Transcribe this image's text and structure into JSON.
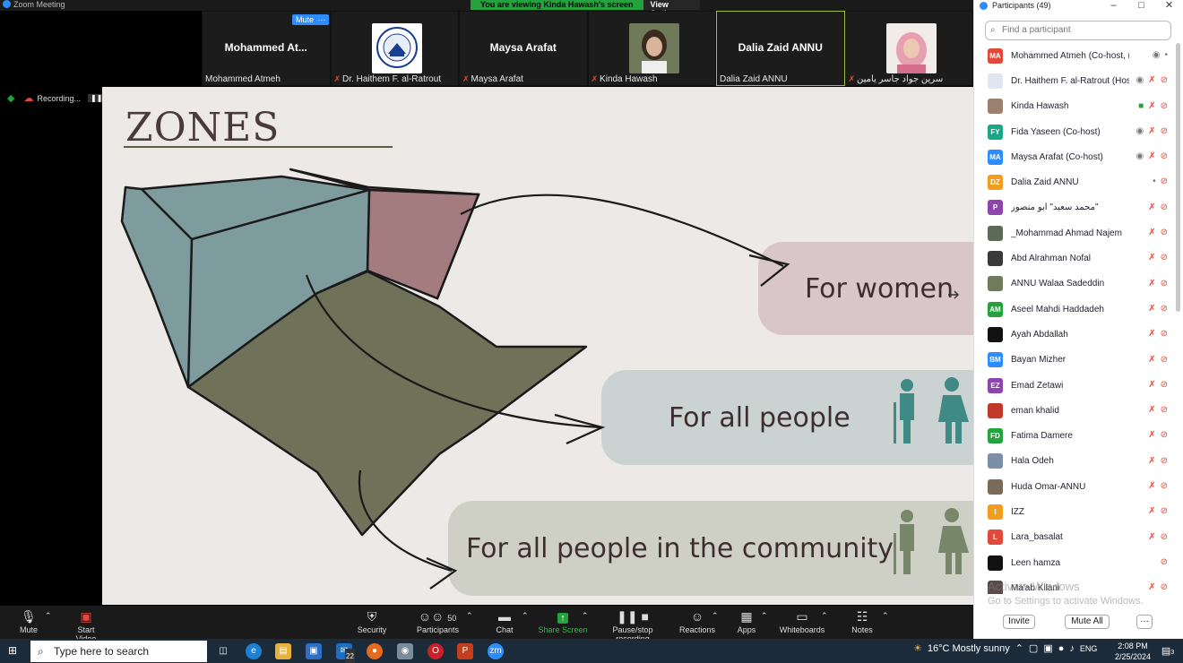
{
  "window": {
    "title": "Zoom Meeting"
  },
  "banner": {
    "viewing": "You are viewing Kinda Hawash's screen",
    "view_options": "View Options"
  },
  "thumbs": [
    {
      "big": "Mohammed  At...",
      "label": "Mohammed Atmeh",
      "muted": false
    },
    {
      "big": "",
      "label": "Dr. Haithem F. al-Ratrout",
      "muted": true
    },
    {
      "big": "Maysa Arafat",
      "label": "Maysa Arafat",
      "muted": true
    },
    {
      "big": "",
      "label": "Kinda Hawash",
      "muted": true
    },
    {
      "big": "Dalia Zaid ANNU",
      "label": "Dalia Zaid ANNU",
      "muted": false
    },
    {
      "big": "",
      "label": "سرين جواد جاسر يامين",
      "muted": true
    }
  ],
  "mute_badge": "Mute",
  "more_badge": "···",
  "recording": {
    "label": "Recording..."
  },
  "slide": {
    "title": "ZONES",
    "zones": [
      "For women",
      "For all people",
      "For all people in the community"
    ]
  },
  "panel": {
    "title": "Participants (49)",
    "search_placeholder": "Find a participant",
    "participants": [
      {
        "initials": "MA",
        "color": "#e0493b",
        "name": "Mohammed Atmeh (Co-host, me)",
        "icons": "cam mic"
      },
      {
        "initials": "",
        "color": "#dfe6ef",
        "name": "Dr. Haithem F. al-Ratrout (Host)",
        "icons": "cam mute vid"
      },
      {
        "initials": "",
        "color": "#9b8070",
        "name": "Kinda Hawash",
        "icons": "share mute vid"
      },
      {
        "initials": "FY",
        "color": "#1aa687",
        "name": "Fida Yaseen (Co-host)",
        "icons": "cam mute vid"
      },
      {
        "initials": "MA",
        "color": "#2d8cff",
        "name": "Maysa Arafat (Co-host)",
        "icons": "cam mute vid"
      },
      {
        "initials": "DZ",
        "color": "#f29d1d",
        "name": "Dalia Zaid ANNU",
        "icons": "mic vid"
      },
      {
        "initials": "P",
        "color": "#8e44ad",
        "name": "محمد سعيد\" ابو منصور\"",
        "icons": "mute vid"
      },
      {
        "initials": "",
        "color": "#5d6a57",
        "name": "_Mohammad Ahmad Najem",
        "icons": "mute vid"
      },
      {
        "initials": "",
        "color": "#3a3a3a",
        "name": "Abd Alrahman Nofal",
        "icons": "mute vid"
      },
      {
        "initials": "",
        "color": "#6f7b5c",
        "name": "ANNU Walaa Sadeddin",
        "icons": "mute vid"
      },
      {
        "initials": "AM",
        "color": "#23a23d",
        "name": "Aseel Mahdi Haddadeh",
        "icons": "mute vid"
      },
      {
        "initials": "",
        "color": "#111111",
        "name": "Ayah Abdallah",
        "icons": "mute vid"
      },
      {
        "initials": "BM",
        "color": "#2d8cff",
        "name": "Bayan Mizher",
        "icons": "mute vid"
      },
      {
        "initials": "EZ",
        "color": "#8e44ad",
        "name": "Emad Zetawi",
        "icons": "mute vid"
      },
      {
        "initials": "",
        "color": "#c0392b",
        "name": "eman khalid",
        "icons": "mute vid"
      },
      {
        "initials": "FD",
        "color": "#23a23d",
        "name": "Fatima Damere",
        "icons": "mute vid"
      },
      {
        "initials": "",
        "color": "#7d8fa6",
        "name": "Hala Odeh",
        "icons": "mute vid"
      },
      {
        "initials": "",
        "color": "#7a6a5a",
        "name": "Huda Omar-ANNU",
        "icons": "mute vid"
      },
      {
        "initials": "I",
        "color": "#f29d1d",
        "name": "IZZ",
        "icons": "mute vid"
      },
      {
        "initials": "L",
        "color": "#e0493b",
        "name": "Lara_basalat",
        "icons": "mute vid"
      },
      {
        "initials": "",
        "color": "#111111",
        "name": "Leen hamza",
        "icons": "vid"
      },
      {
        "initials": "",
        "color": "#5a4a4a",
        "name": "Ma'ab Kilani",
        "icons": "mute vid"
      }
    ],
    "invite": "Invite",
    "mute_all": "Mute All",
    "more": "···"
  },
  "activate": {
    "line1": "Activate Windows",
    "line2": "Go to Settings to activate Windows."
  },
  "toolbar": {
    "mute": "Mute",
    "start_video": "Start Video",
    "security": "Security",
    "participants": "Participants",
    "participants_count": "50",
    "chat": "Chat",
    "share_screen": "Share Screen",
    "pause_recording": "Pause/stop recording",
    "reactions": "Reactions",
    "apps": "Apps",
    "whiteboards": "Whiteboards",
    "notes": "Notes"
  },
  "taskbar": {
    "search_placeholder": "Type here to search",
    "mail_badge": "22",
    "weather": "16°C  Mostly sunny",
    "lang": "ENG",
    "time": "2:08 PM",
    "date": "2/25/2024",
    "notif_count": "3"
  },
  "colors": {
    "zoom_blue": "#2d8cff",
    "muted_red": "#e0493b",
    "share_green": "#23a23d",
    "slide_bg": "#ede9e6"
  }
}
